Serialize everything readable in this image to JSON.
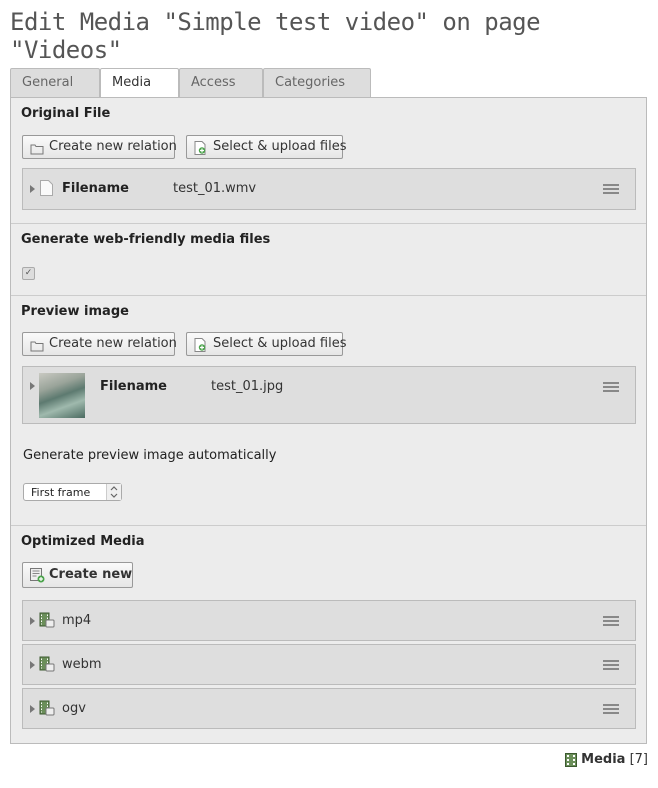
{
  "page_title": "Edit Media \"Simple test video\" on page \"Videos\"",
  "tabs": [
    {
      "label": "General",
      "active": false
    },
    {
      "label": "Media",
      "active": true
    },
    {
      "label": "Access",
      "active": false
    },
    {
      "label": "Categories",
      "active": false
    }
  ],
  "original_file": {
    "heading": "Original File",
    "create_relation_label": "Create new relation",
    "upload_label": "Select & upload files",
    "record": {
      "field_label": "Filename",
      "value": "test_01.wmv",
      "icon": "file-icon"
    }
  },
  "web_friendly": {
    "heading": "Generate web-friendly media files",
    "checked": true
  },
  "preview_image": {
    "heading": "Preview image",
    "create_relation_label": "Create new relation",
    "upload_label": "Select & upload files",
    "record": {
      "field_label": "Filename",
      "value": "test_01.jpg"
    },
    "auto_label": "Generate preview image automatically",
    "select_value": "First frame"
  },
  "optimized_media": {
    "heading": "Optimized Media",
    "create_new_label": "Create new",
    "items": [
      {
        "label": "mp4"
      },
      {
        "label": "webm"
      },
      {
        "label": "ogv"
      }
    ]
  },
  "footer": {
    "label": "Media",
    "count": "[7]"
  },
  "colors": {
    "panel_bg": "#ececec",
    "record_bg": "#dedede",
    "title_text": "#555555"
  }
}
